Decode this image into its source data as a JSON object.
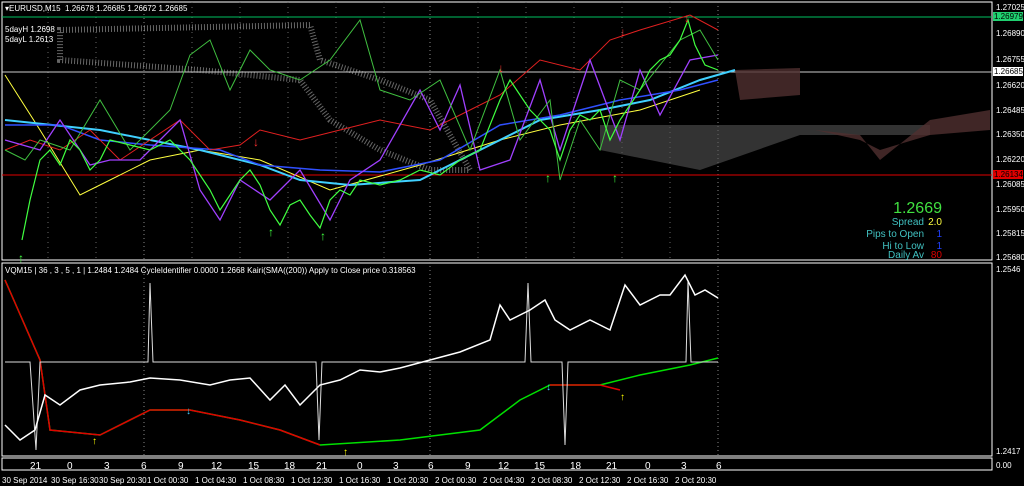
{
  "header": {
    "symbol": "EURUSD,M15",
    "ohlc": "1.26678 1.26685 1.26672 1.26685",
    "day_high": "5dayH 1.2698",
    "day_low": "5dayL 1.2613"
  },
  "price_scale": [
    "1.27025",
    "1.26890",
    "1.26755",
    "1.26620",
    "1.26485",
    "1.26350",
    "1.26220",
    "1.26085",
    "1.25950",
    "1.25815",
    "1.25680"
  ],
  "price_tags": {
    "green": "1.26979",
    "white": "1.26685",
    "red": "1.26134"
  },
  "info_panel": {
    "price": "1.2669",
    "spread_label": "Spread",
    "spread_value": "2.0",
    "pips_label": "Pips to Open",
    "pips_value": "1",
    "hilo_label": "Hi to Low",
    "hilo_value": "1",
    "daily_label": "Daily Av",
    "daily_value": "80"
  },
  "indicator": {
    "title": "VQM15 | 36 , 3 , 5 , 1  |  1.2484 1.2484  CycleIdentifier 0.0000 1.2668  Kairi(SMA((200)) Apply to Close price 0.318563",
    "scale_top": "1.2546",
    "scale_bottom": "1.2417",
    "scale_zero": "0.00"
  },
  "hours": [
    "21",
    "0",
    "3",
    "6",
    "9",
    "12",
    "15",
    "18",
    "21",
    "0",
    "3",
    "6",
    "9",
    "12",
    "15",
    "18",
    "21",
    "0",
    "3",
    "6"
  ],
  "dates": [
    "30 Sep 2014",
    "30 Sep 16:30",
    "30 Sep 20:30",
    "1 Oct 00:30",
    "1 Oct 04:30",
    "1 Oct 08:30",
    "1 Oct 12:30",
    "1 Oct 16:30",
    "1 Oct 20:30",
    "2 Oct 00:30",
    "2 Oct 04:30",
    "2 Oct 08:30",
    "2 Oct 12:30",
    "2 Oct 16:30",
    "2 Oct 20:30"
  ],
  "colors": {
    "green": "#00e000",
    "red": "#ff0000",
    "spread": "#ffff00",
    "blue": "#0000ff",
    "cyan": "#40c0ff"
  }
}
